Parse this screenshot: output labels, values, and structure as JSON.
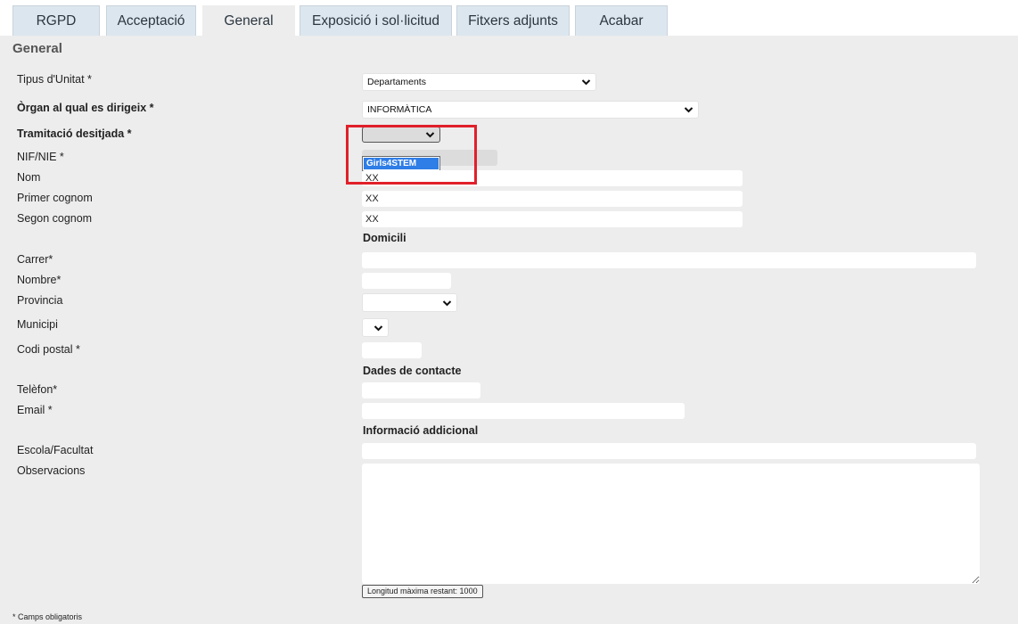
{
  "tabs": [
    {
      "label": "RGPD"
    },
    {
      "label": "Acceptació"
    },
    {
      "label": "General"
    },
    {
      "label": "Exposició i sol·licitud"
    },
    {
      "label": "Fitxers adjunts"
    },
    {
      "label": "Acabar"
    }
  ],
  "active_tab": "General",
  "section_title": "General",
  "fields": {
    "tipus_unitat": {
      "label": "Tipus d'Unitat *",
      "value": "Departaments"
    },
    "organ": {
      "label": "Òrgan al qual es dirigeix *",
      "value": "INFORMÀTICA"
    },
    "tramitacio": {
      "label": "Tramitació desitjada *",
      "value": "",
      "open_option": "Girls4STEM"
    },
    "nif": {
      "label": "NIF/NIE *",
      "value": ""
    },
    "nom": {
      "label": "Nom",
      "value": "XX"
    },
    "primer_cognom": {
      "label": "Primer cognom",
      "value": "XX"
    },
    "segon_cognom": {
      "label": "Segon cognom",
      "value": "XX"
    },
    "domicili_heading": "Domicili",
    "carrer": {
      "label": "Carrer*",
      "value": ""
    },
    "nombre": {
      "label": "Nombre*",
      "value": ""
    },
    "provincia": {
      "label": "Provincia",
      "value": ""
    },
    "municipi": {
      "label": "Municipi",
      "value": ""
    },
    "codi_postal": {
      "label": "Codi postal *",
      "value": ""
    },
    "contacte_heading": "Dades de contacte",
    "telefon": {
      "label": "Telèfon*",
      "value": ""
    },
    "email": {
      "label": "Email *",
      "value": ""
    },
    "info_heading": "Informació addicional",
    "escola": {
      "label": "Escola/Facultat",
      "value": ""
    },
    "observacions": {
      "label": "Observacions",
      "value": ""
    }
  },
  "counter_text": "Longitud màxima restant: 1000",
  "footnote": "* Camps obligatoris",
  "colors": {
    "highlight": "#e0202a",
    "tab_bg": "#dce6ee",
    "panel_bg": "#ededed",
    "option_selected": "#2f7de6"
  }
}
